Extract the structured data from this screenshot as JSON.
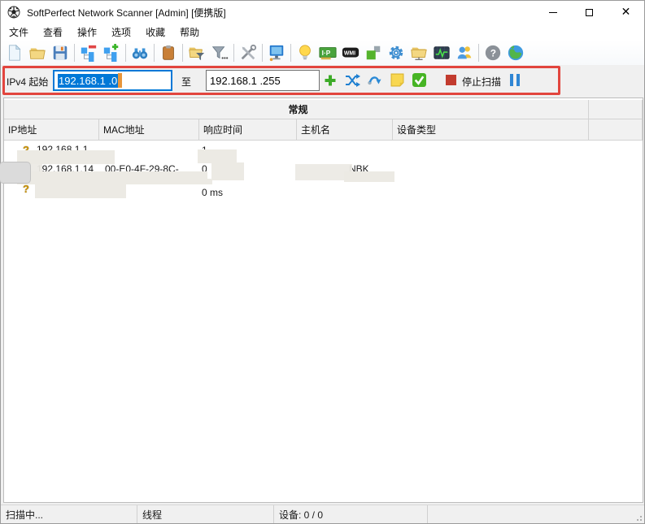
{
  "window": {
    "title": "SoftPerfect Network Scanner [Admin] [便携版]"
  },
  "menu": {
    "items": [
      "文件",
      "查看",
      "操作",
      "选项",
      "收藏",
      "帮助"
    ]
  },
  "toolbar": {
    "icons": [
      "new-document",
      "open-file",
      "save",
      "collapse-tree",
      "expand-tree",
      "find",
      "paste",
      "filter-folder",
      "filter-more",
      "tools",
      "remote-computer",
      "hints-bulb",
      "ip-card",
      "wmi",
      "green-blocks",
      "settings-gear",
      "shared-folder",
      "activity-monitor",
      "users",
      "help",
      "web-globe"
    ]
  },
  "scan_bar": {
    "start_label": "IPv4 起始",
    "start_value": "192.168.1 .0",
    "to_label": "至",
    "end_value": "192.168.1 .255",
    "action_icons": [
      "add-range",
      "random-range",
      "trace-route",
      "note",
      "auto-detect-check"
    ],
    "stop_label": "停止扫描",
    "highlight_color": "#e2453e",
    "selection_color": "#0078d7"
  },
  "grid": {
    "group_header": "常规",
    "columns": [
      "IP地址",
      "MAC地址",
      "响应时间",
      "主机名",
      "设备类型"
    ],
    "rows": [
      {
        "ip": "192.168.1.1",
        "mac": "",
        "response": "1",
        "hostname": "",
        "device_type": "",
        "redacted": true
      },
      {
        "ip": "192.168.1.14",
        "mac": "00-E0-4F-29-8C-",
        "response": "0",
        "hostname_fragment": "NBK",
        "device_type": "",
        "redacted": true
      },
      {
        "ip": "",
        "mac": "",
        "response": "0 ms",
        "hostname": "",
        "device_type": "",
        "redacted": true
      }
    ]
  },
  "status_bar": {
    "panels": [
      "扫描中...",
      "线程",
      "设备: 0 / 0",
      ""
    ]
  }
}
